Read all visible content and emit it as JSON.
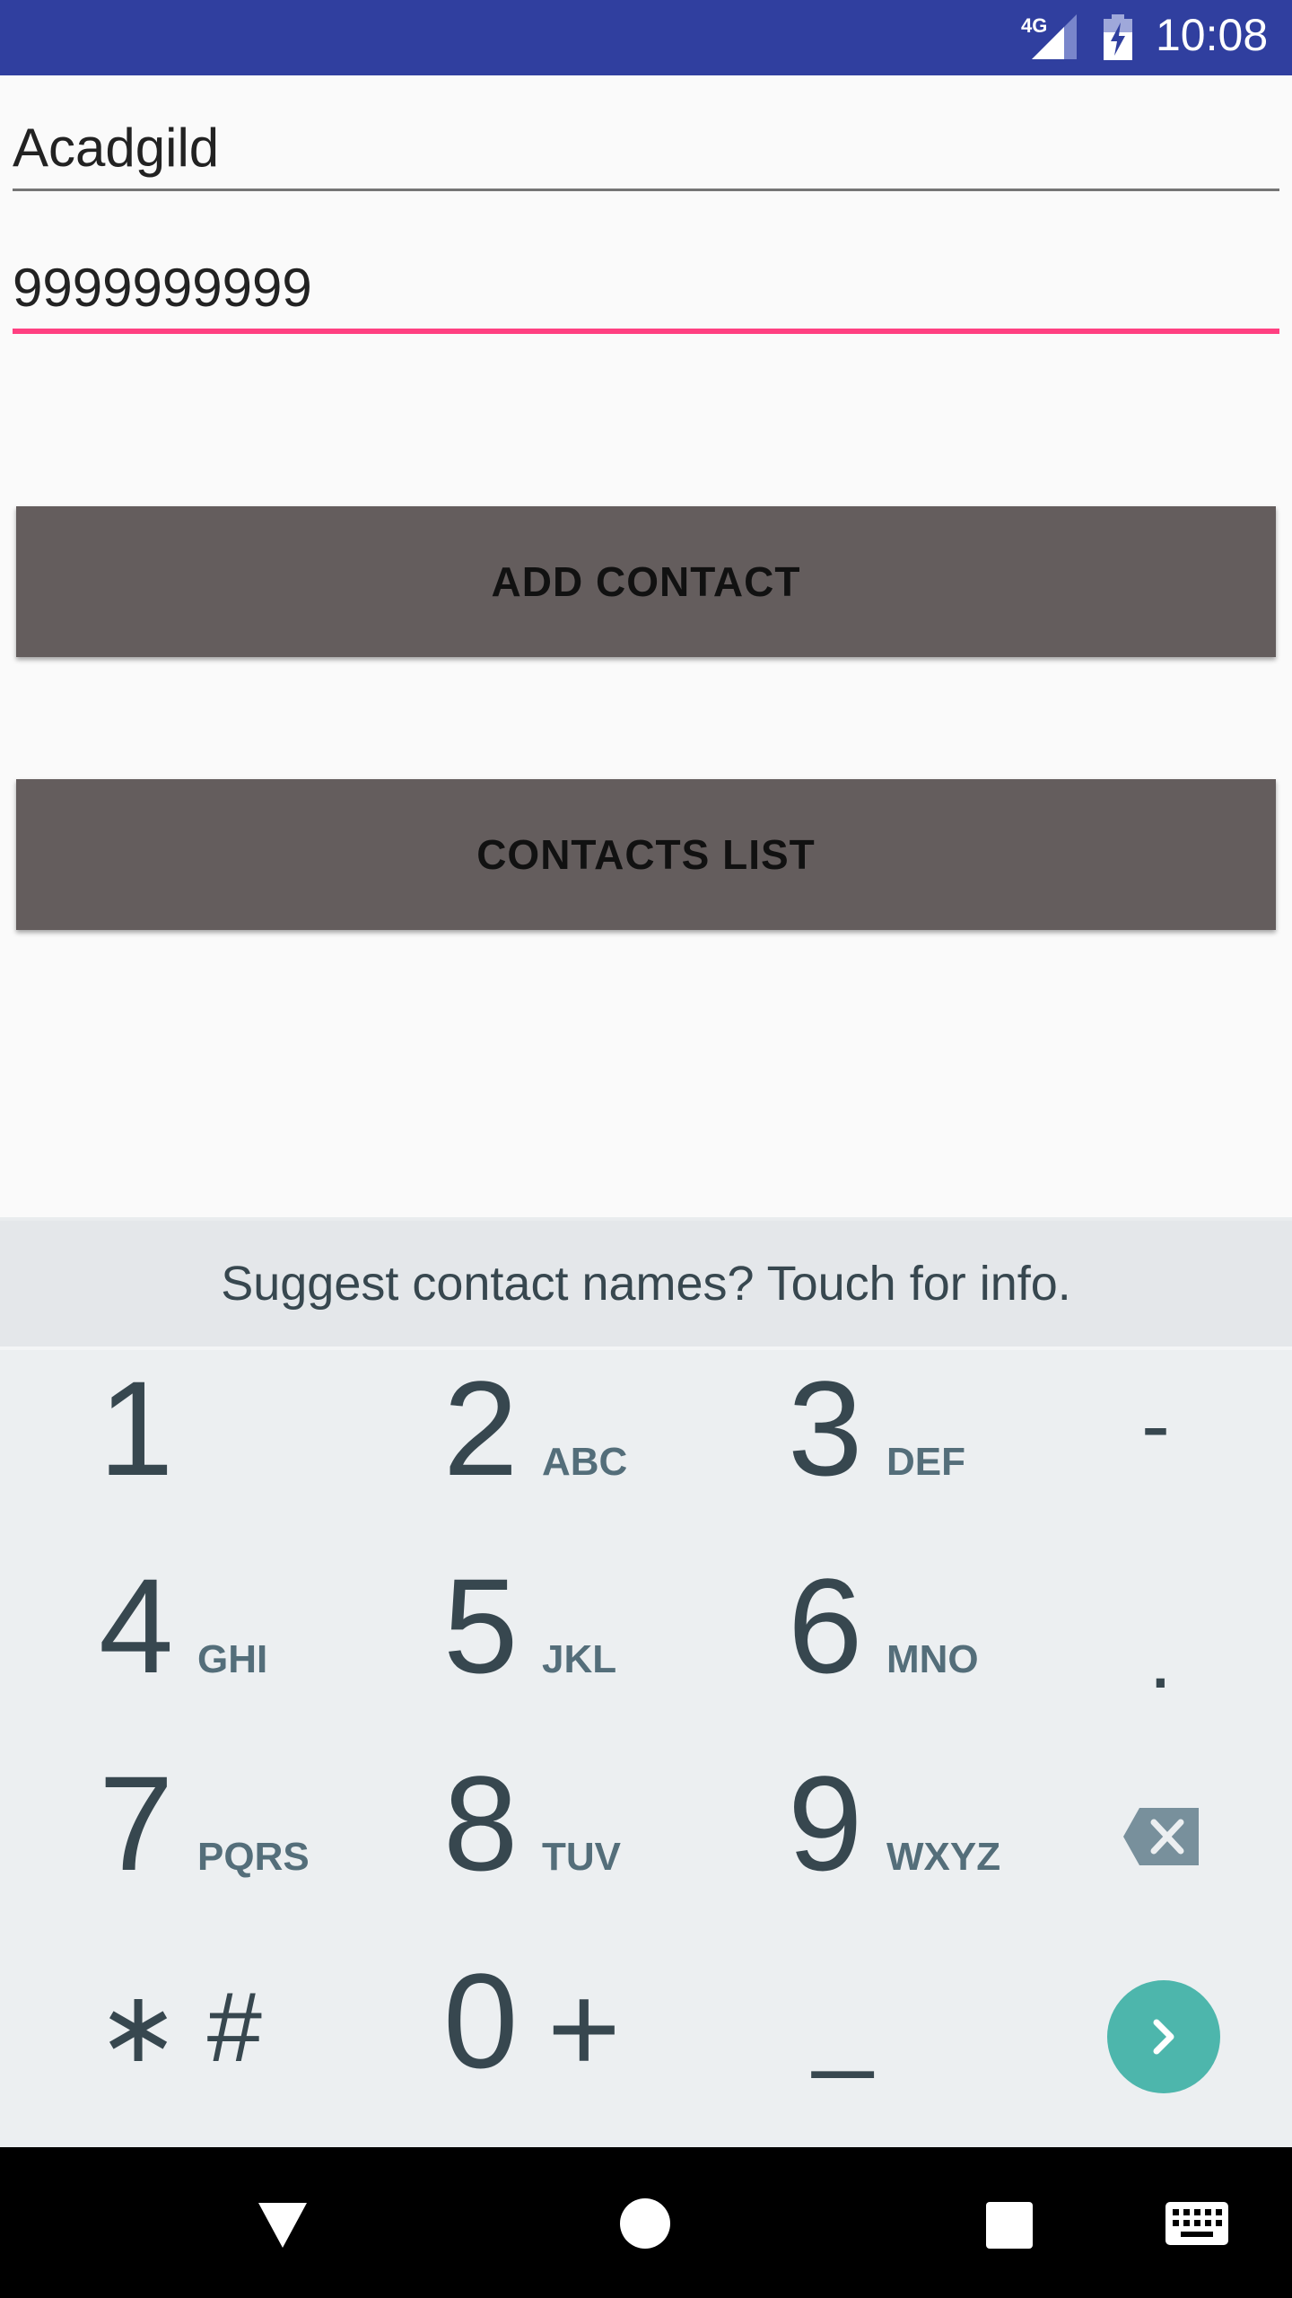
{
  "status_bar": {
    "network": "4G",
    "time": "10:08",
    "color": "#303f9f"
  },
  "form": {
    "name_value": "Acadgild",
    "phone_value": "9999999999",
    "accent_color": "#ff4081"
  },
  "buttons": {
    "add_contact": "ADD CONTACT",
    "contacts_list": "CONTACTS LIST"
  },
  "keyboard": {
    "suggestion": "Suggest contact names? Touch for info.",
    "keys": [
      {
        "num": "1",
        "letters": ""
      },
      {
        "num": "2",
        "letters": "ABC"
      },
      {
        "num": "3",
        "letters": "DEF"
      },
      {
        "num": "4",
        "letters": "GHI"
      },
      {
        "num": "5",
        "letters": "JKL"
      },
      {
        "num": "6",
        "letters": "MNO"
      },
      {
        "num": "7",
        "letters": "PQRS"
      },
      {
        "num": "8",
        "letters": "TUV"
      },
      {
        "num": "9",
        "letters": "WXYZ"
      },
      {
        "num": "0",
        "letters": ""
      }
    ],
    "symbols": {
      "dash": "-",
      "period": ".",
      "star_hash": "∗ #",
      "plus": "+",
      "underscore": "_"
    },
    "icons": {
      "backspace": "backspace-icon",
      "go": "chevron-right-icon"
    },
    "go_color": "#4db6ac"
  },
  "nav_bar": {
    "icons": [
      "back-icon",
      "home-icon",
      "recents-icon",
      "keyboard-icon"
    ]
  }
}
